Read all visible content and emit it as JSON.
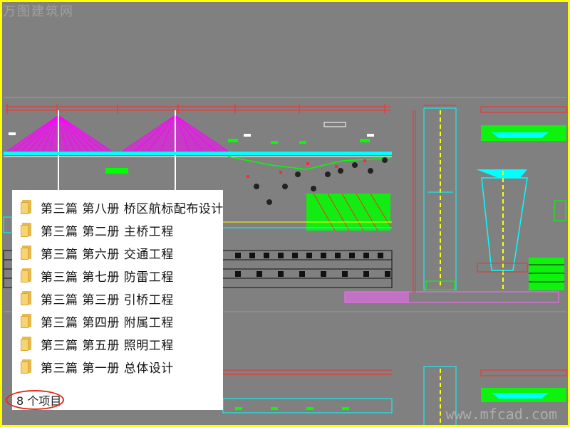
{
  "watermark_top": "万图建筑网",
  "watermark_bottom": "www.mfcad.com",
  "folders": [
    {
      "label": "第三篇 第八册 桥区航标配布设计",
      "icon": "folder-icon"
    },
    {
      "label": "第三篇 第二册 主桥工程",
      "icon": "folder-icon"
    },
    {
      "label": "第三篇 第六册  交通工程",
      "icon": "folder-icon"
    },
    {
      "label": "第三篇 第七册 防雷工程",
      "icon": "folder-icon"
    },
    {
      "label": "第三篇 第三册 引桥工程",
      "icon": "folder-icon"
    },
    {
      "label": "第三篇 第四册 附属工程",
      "icon": "folder-icon"
    },
    {
      "label": "第三篇 第五册  照明工程",
      "icon": "folder-icon"
    },
    {
      "label": "第三篇 第一册 总体设计",
      "icon": "folder-icon"
    }
  ],
  "status": "8 个项目",
  "colors": {
    "frame": "#ffff00",
    "highlight": "#e8291b",
    "background": "#808080",
    "cable": "#ff00ff",
    "accent_green": "#00ff00",
    "accent_cyan": "#00ffff",
    "accent_red": "#ff0000"
  }
}
